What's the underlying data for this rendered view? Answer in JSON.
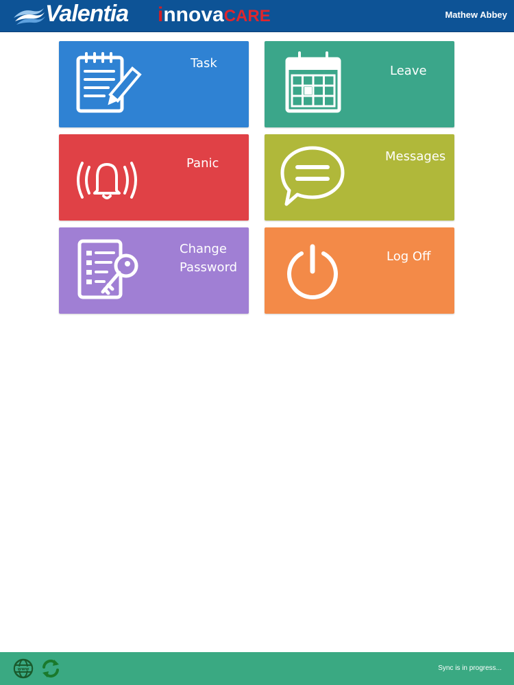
{
  "header": {
    "brand_primary": "Valentia",
    "brand_secondary_i": "i",
    "brand_secondary_main": "nnova",
    "brand_secondary_suffix": "CARE",
    "user_name": "Mathew Abbey"
  },
  "tiles": [
    {
      "label": "Task",
      "icon": "task-notepad-icon",
      "color": "#2f82d3"
    },
    {
      "label": "Leave",
      "icon": "calendar-icon",
      "color": "#3ba68a"
    },
    {
      "label": "Panic",
      "icon": "alarm-bell-icon",
      "color": "#e04146"
    },
    {
      "label": "Messages",
      "icon": "chat-bubble-icon",
      "color": "#b0b83a"
    },
    {
      "label": "Change\nPassword",
      "icon": "password-key-icon",
      "color": "#a07fd4"
    },
    {
      "label": "Log Off",
      "icon": "power-icon",
      "color": "#f38a48"
    }
  ],
  "footer": {
    "sync_status": "Sync is in progress...",
    "left_icons": [
      "globe-www-icon",
      "sync-icon"
    ],
    "color": "#3aa982"
  }
}
